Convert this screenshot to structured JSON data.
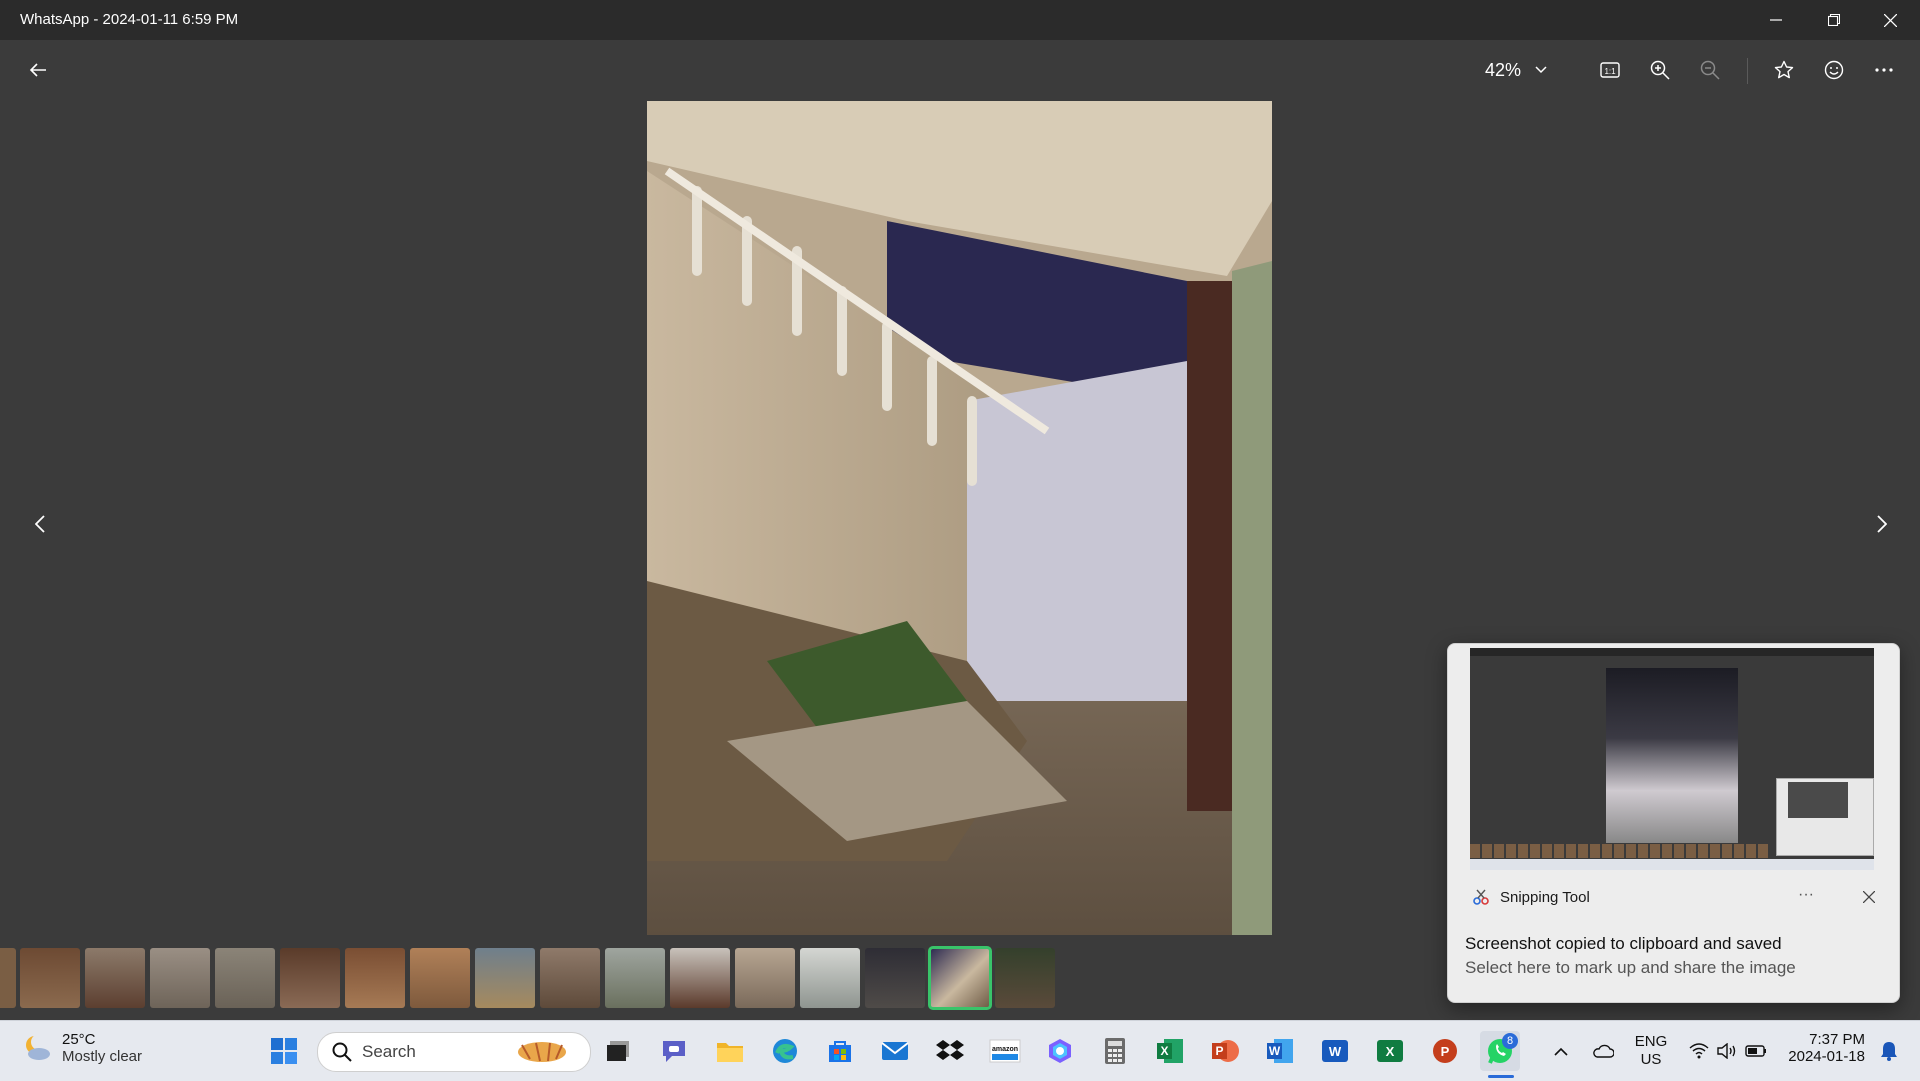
{
  "window": {
    "title": "WhatsApp - 2024-01-11 6:59 PM",
    "controls": [
      "minimize-icon",
      "restore-icon",
      "close-icon"
    ]
  },
  "toolbar": {
    "back_icon": "arrow-left-icon",
    "zoom_level": "42%",
    "zoom_dropdown_icon": "chevron-down-icon",
    "buttons": [
      "actual-size-icon",
      "zoom-in-icon",
      "zoom-out-icon",
      "star-icon",
      "emoji-icon",
      "more-icon"
    ]
  },
  "viewer": {
    "prev_icon": "chevron-left-icon",
    "next_icon": "chevron-right-icon"
  },
  "filmstrip": {
    "thumbnail_count": 16,
    "selected_index": 14
  },
  "toast": {
    "app_name": "Snipping Tool",
    "more_label": "···",
    "title": "Screenshot copied to clipboard and saved",
    "subtitle": "Select here to mark up and share the image"
  },
  "taskbar": {
    "weather": {
      "temp": "25°C",
      "desc": "Mostly clear",
      "icon": "moon-cloud-icon"
    },
    "search_placeholder": "Search",
    "apps": [
      "start-icon",
      "task-view-icon",
      "teams-icon",
      "file-explorer-icon",
      "edge-icon",
      "store-icon",
      "mail-icon",
      "dropbox-icon",
      "amazon-icon",
      "copilot-icon",
      "calculator-icon",
      "excel-icon",
      "powerpoint-icon",
      "word-icon",
      "word-icon",
      "excel-icon",
      "powerpoint-icon",
      "whatsapp-icon"
    ],
    "whatsapp_badge": "8",
    "tray": {
      "language": "ENG",
      "region": "US",
      "time": "7:37 PM",
      "date": "2024-01-18"
    }
  },
  "colors": {
    "titlebar": "#2b2b2b",
    "background": "#3b3b3b",
    "selection": "#39c46a",
    "taskbar": "#e6e9ef",
    "accent": "#2a6bd8"
  }
}
